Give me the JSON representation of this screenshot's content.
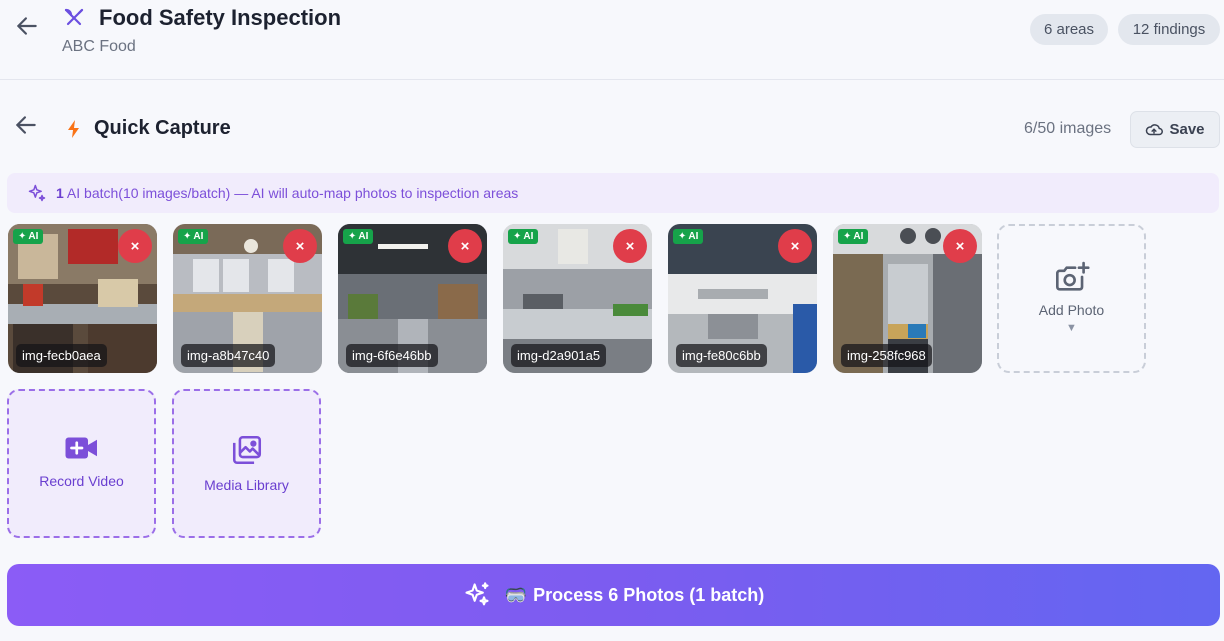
{
  "header": {
    "title": "Food Safety Inspection",
    "subtitle": "ABC Food",
    "areas_pill": "6 areas",
    "findings_pill": "12 findings"
  },
  "capture": {
    "title": "Quick Capture",
    "image_count": "6/50 images",
    "save_label": "Save"
  },
  "ai_banner": {
    "batch_count": "1",
    "text": "AI batch(10 images/batch) — AI will auto-map photos to inspection areas"
  },
  "images": [
    {
      "label": "img-fecb0aea",
      "badge": "AI",
      "remove": "×"
    },
    {
      "label": "img-a8b47c40",
      "badge": "AI",
      "remove": "×"
    },
    {
      "label": "img-6f6e46bb",
      "badge": "AI",
      "remove": "×"
    },
    {
      "label": "img-d2a901a5",
      "badge": "AI",
      "remove": "×"
    },
    {
      "label": "img-fe80c6bb",
      "badge": "AI",
      "remove": "×"
    },
    {
      "label": "img-258fc968",
      "badge": "AI",
      "remove": "×"
    }
  ],
  "tiles": {
    "add_photo": "Add Photo",
    "add_caret": "▼",
    "record_video": "Record Video",
    "media_library": "Media Library"
  },
  "process": {
    "emoji": "🥽",
    "label": "Process 6 Photos (1 batch)"
  },
  "icons": {
    "back": "arrow-left-icon",
    "title": "utensils-icon",
    "bolt": "bolt-icon",
    "save": "cloud-upload-icon",
    "sparkles": "sparkles-icon",
    "camera_plus": "camera-plus-icon",
    "video_plus": "video-plus-icon",
    "media": "images-icon"
  },
  "colors": {
    "accent": "#7c5cf0",
    "remove": "#e03d4a",
    "ai_badge": "#16a34a",
    "bolt": "#f97316"
  }
}
